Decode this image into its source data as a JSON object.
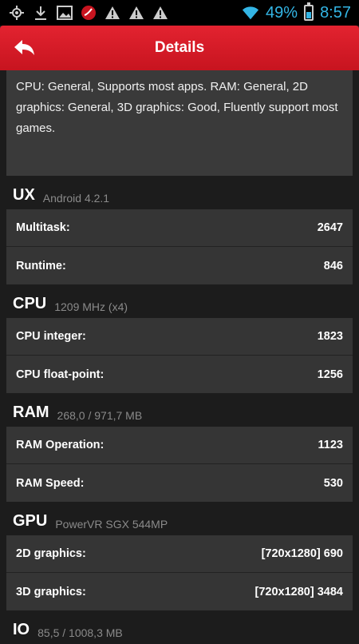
{
  "statusbar": {
    "battery_percent": "49%",
    "time": "8:57",
    "left_icons": [
      "gps-icon",
      "download-icon",
      "image-icon",
      "app-icon",
      "warning-icon",
      "warning-icon",
      "warning-icon"
    ],
    "battery_level": 0.49
  },
  "header": {
    "title": "Details"
  },
  "description": "CPU: General, Supports most apps. RAM: General, 2D graphics: General, 3D graphics: Good, Fluently support most games.",
  "sections": [
    {
      "title": "UX",
      "subtitle": "Android 4.2.1",
      "rows": [
        {
          "label": "Multitask:",
          "value": "2647"
        },
        {
          "label": "Runtime:",
          "value": "846"
        }
      ]
    },
    {
      "title": "CPU",
      "subtitle": "1209 MHz (x4)",
      "rows": [
        {
          "label": "CPU integer:",
          "value": "1823"
        },
        {
          "label": "CPU float-point:",
          "value": "1256"
        }
      ]
    },
    {
      "title": "RAM",
      "subtitle": "268,0 / 971,7 MB",
      "rows": [
        {
          "label": "RAM Operation:",
          "value": "1123"
        },
        {
          "label": "RAM Speed:",
          "value": "530"
        }
      ]
    },
    {
      "title": "GPU",
      "subtitle": "PowerVR SGX 544MP",
      "rows": [
        {
          "label": "2D graphics:",
          "value": "[720x1280] 690"
        },
        {
          "label": "3D graphics:",
          "value": "[720x1280] 3484"
        }
      ]
    },
    {
      "title": "IO",
      "subtitle": "85,5 / 1008,3 MB",
      "rows": []
    }
  ],
  "colors": {
    "accent": "#33b5e5",
    "header_red": "#d81b27",
    "card": "#353535"
  }
}
